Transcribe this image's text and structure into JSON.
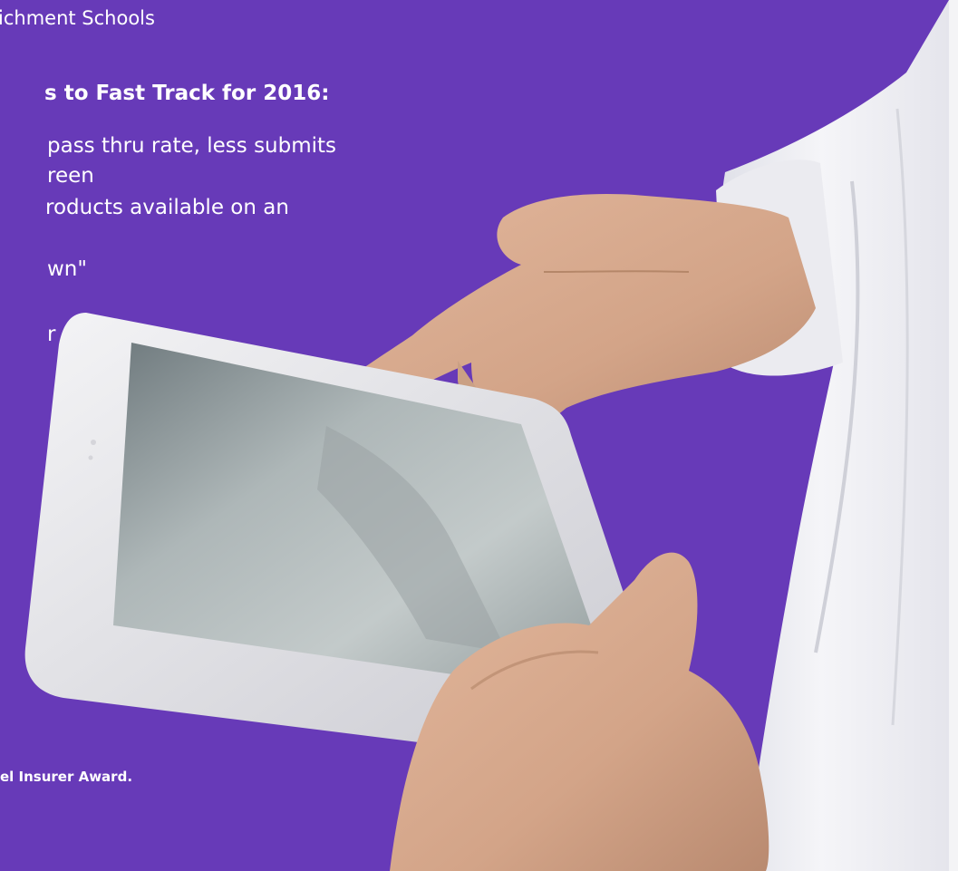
{
  "slide": {
    "top_line": "ichment Schools",
    "heading": "s to Fast Track for 2016:",
    "bullet_fragments": [
      "pass thru rate, less submits",
      "reen",
      "roducts available on an",
      "wn\"",
      "r"
    ],
    "footer_fragment": "el Insurer Award."
  },
  "colors": {
    "background": "#673ab8",
    "text": "#ffffff",
    "coat": "#eeeef2",
    "skin": "#d4a688",
    "tablet_frame": "#ecebef",
    "screen": "#9ea6a8"
  },
  "photo": {
    "icon": "hand-pointing-at-tablet"
  }
}
